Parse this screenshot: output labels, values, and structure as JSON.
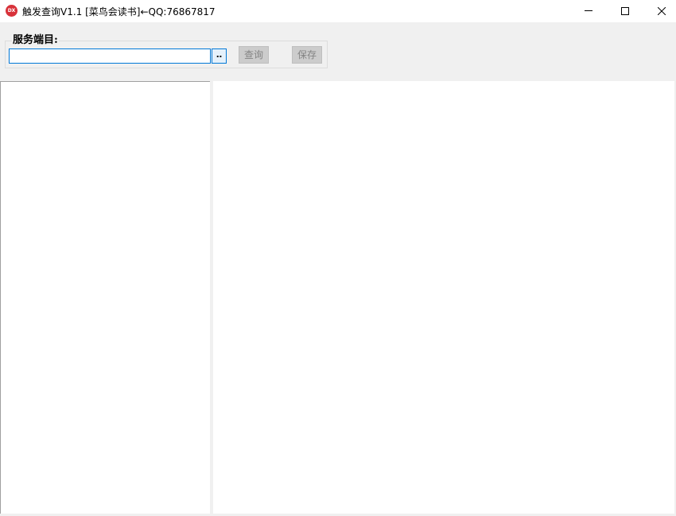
{
  "window": {
    "title": "触发查询V1.1 [菜鸟会读书]←QQ:76867817",
    "icon": "app-logo-icon",
    "icon_text": "DX",
    "controls": [
      "minimize-icon",
      "maximize-icon",
      "close-icon"
    ]
  },
  "toolbar": {
    "group_label": "服务端目:",
    "server_input_value": "",
    "browse_label": "‥",
    "query_label": "查询",
    "save_label": "保存"
  },
  "colors": {
    "accent": "#0078d7",
    "app_icon": "#d8323a",
    "disabled_button": "#cccccc"
  }
}
